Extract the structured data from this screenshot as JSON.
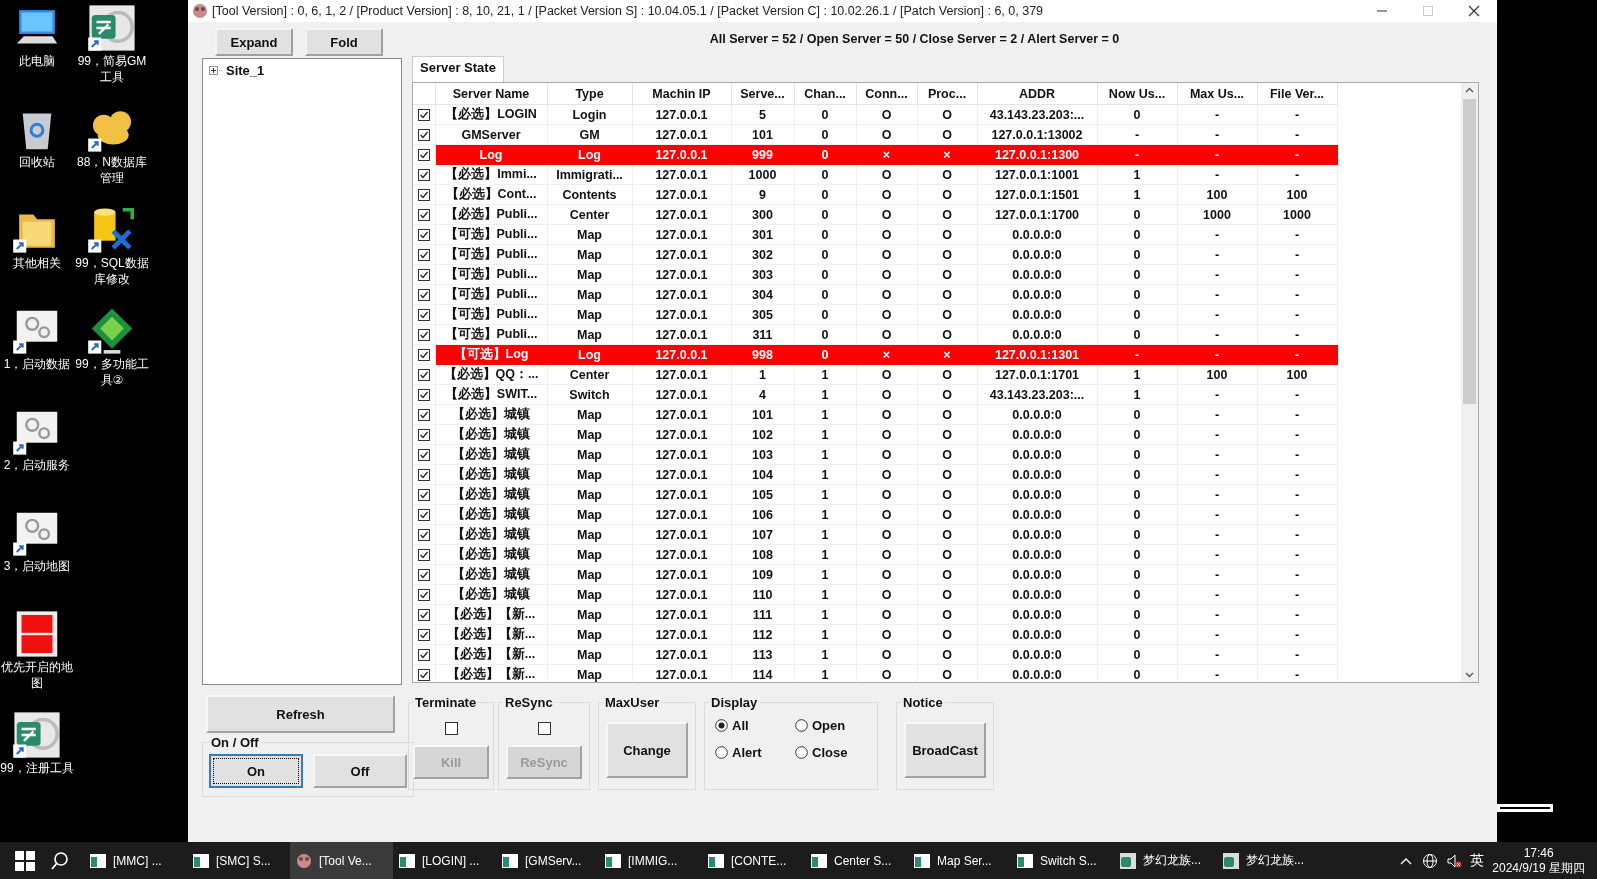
{
  "desktop": {
    "columns": [
      [
        {
          "label": "此电脑",
          "kind": "computer",
          "shortcut": false
        },
        {
          "label": "回收站",
          "kind": "recycle",
          "shortcut": false
        },
        {
          "label": "其他相关",
          "kind": "folder",
          "shortcut": true
        },
        {
          "label": "1，启动数据",
          "kind": "gears",
          "shortcut": true
        },
        {
          "label": "2，启动服务",
          "kind": "gears",
          "shortcut": true
        },
        {
          "label": "3，启动地图",
          "kind": "gears",
          "shortcut": true
        },
        {
          "label": "优先开启的地图",
          "kind": "redgrid",
          "shortcut": false
        },
        {
          "label": "99，注册工具",
          "kind": "gm",
          "shortcut": true
        }
      ],
      [
        {
          "label": "99，简易GM工具",
          "kind": "gm",
          "shortcut": true
        },
        {
          "label": "88，N数据库管理",
          "kind": "blob",
          "shortcut": true
        },
        {
          "label": "99，SQL数据库修改",
          "kind": "sql",
          "shortcut": true
        },
        {
          "label": "99，多功能工具②",
          "kind": "diamond",
          "shortcut": true
        }
      ]
    ]
  },
  "window": {
    "title": "[Tool Version] : 0, 6, 1, 2 / [Product Version] : 8, 10, 21, 1 / [Packet Version S] : 10.04.05.1 / [Packet Version C] : 10.02.26.1 / [Patch Version] : 6, 0, 379"
  },
  "tree_buttons": [
    "Expand",
    "Fold"
  ],
  "tree": [
    {
      "label": "Site_1",
      "expanded": false
    }
  ],
  "summary": "All Server = 52 / Open Server = 50 / Close Server = 2 / Alert Server = 0",
  "tabs": [
    {
      "label": "Server State",
      "selected": true
    }
  ],
  "table": {
    "columns": [
      "Server Name",
      "Type",
      "Machin IP",
      "Serve...",
      "Chan...",
      "Conn...",
      "Proc...",
      "ADDR",
      "Now Us...",
      "Max Us...",
      "File Ver..."
    ],
    "rows": [
      {
        "checked": true,
        "alert": false,
        "cells": [
          "【必选】LOGIN",
          "Login",
          "127.0.0.1",
          "5",
          "0",
          "O",
          "O",
          "43.143.23.203:...",
          "0",
          "-",
          "-"
        ]
      },
      {
        "checked": true,
        "alert": false,
        "cells": [
          "GMServer",
          "GM",
          "127.0.0.1",
          "101",
          "0",
          "O",
          "O",
          "127.0.0.1:13002",
          "-",
          "-",
          "-"
        ]
      },
      {
        "checked": true,
        "alert": true,
        "cells": [
          "Log",
          "Log",
          "127.0.0.1",
          "999",
          "0",
          "×",
          "×",
          "127.0.0.1:1300",
          "-",
          "-",
          "-"
        ]
      },
      {
        "checked": true,
        "alert": false,
        "cells": [
          "【必选】Immi...",
          "Immigrati...",
          "127.0.0.1",
          "1000",
          "0",
          "O",
          "O",
          "127.0.0.1:1001",
          "1",
          "-",
          "-"
        ]
      },
      {
        "checked": true,
        "alert": false,
        "cells": [
          "【必选】Cont...",
          "Contents",
          "127.0.0.1",
          "9",
          "0",
          "O",
          "O",
          "127.0.0.1:1501",
          "1",
          "100",
          "100"
        ]
      },
      {
        "checked": true,
        "alert": false,
        "cells": [
          "【必选】Publi...",
          "Center",
          "127.0.0.1",
          "300",
          "0",
          "O",
          "O",
          "127.0.0.1:1700",
          "0",
          "1000",
          "1000"
        ]
      },
      {
        "checked": true,
        "alert": false,
        "cells": [
          "【可选】Publi...",
          "Map",
          "127.0.0.1",
          "301",
          "0",
          "O",
          "O",
          "0.0.0.0:0",
          "0",
          "-",
          "-"
        ]
      },
      {
        "checked": true,
        "alert": false,
        "cells": [
          "【可选】Publi...",
          "Map",
          "127.0.0.1",
          "302",
          "0",
          "O",
          "O",
          "0.0.0.0:0",
          "0",
          "-",
          "-"
        ]
      },
      {
        "checked": true,
        "alert": false,
        "cells": [
          "【可选】Publi...",
          "Map",
          "127.0.0.1",
          "303",
          "0",
          "O",
          "O",
          "0.0.0.0:0",
          "0",
          "-",
          "-"
        ]
      },
      {
        "checked": true,
        "alert": false,
        "cells": [
          "【可选】Publi...",
          "Map",
          "127.0.0.1",
          "304",
          "0",
          "O",
          "O",
          "0.0.0.0:0",
          "0",
          "-",
          "-"
        ]
      },
      {
        "checked": true,
        "alert": false,
        "cells": [
          "【可选】Publi...",
          "Map",
          "127.0.0.1",
          "305",
          "0",
          "O",
          "O",
          "0.0.0.0:0",
          "0",
          "-",
          "-"
        ]
      },
      {
        "checked": true,
        "alert": false,
        "cells": [
          "【可选】Publi...",
          "Map",
          "127.0.0.1",
          "311",
          "0",
          "O",
          "O",
          "0.0.0.0:0",
          "0",
          "-",
          "-"
        ]
      },
      {
        "checked": true,
        "alert": true,
        "cells": [
          "【可选】Log",
          "Log",
          "127.0.0.1",
          "998",
          "0",
          "×",
          "×",
          "127.0.0.1:1301",
          "-",
          "-",
          "-"
        ]
      },
      {
        "checked": true,
        "alert": false,
        "cells": [
          "【必选】QQ：...",
          "Center",
          "127.0.0.1",
          "1",
          "1",
          "O",
          "O",
          "127.0.0.1:1701",
          "1",
          "100",
          "100"
        ]
      },
      {
        "checked": true,
        "alert": false,
        "cells": [
          "【必选】SWIT...",
          "Switch",
          "127.0.0.1",
          "4",
          "1",
          "O",
          "O",
          "43.143.23.203:...",
          "1",
          "-",
          "-"
        ]
      },
      {
        "checked": true,
        "alert": false,
        "cells": [
          "【必选】城镇",
          "Map",
          "127.0.0.1",
          "101",
          "1",
          "O",
          "O",
          "0.0.0.0:0",
          "0",
          "-",
          "-"
        ]
      },
      {
        "checked": true,
        "alert": false,
        "cells": [
          "【必选】城镇",
          "Map",
          "127.0.0.1",
          "102",
          "1",
          "O",
          "O",
          "0.0.0.0:0",
          "0",
          "-",
          "-"
        ]
      },
      {
        "checked": true,
        "alert": false,
        "cells": [
          "【必选】城镇",
          "Map",
          "127.0.0.1",
          "103",
          "1",
          "O",
          "O",
          "0.0.0.0:0",
          "0",
          "-",
          "-"
        ]
      },
      {
        "checked": true,
        "alert": false,
        "cells": [
          "【必选】城镇",
          "Map",
          "127.0.0.1",
          "104",
          "1",
          "O",
          "O",
          "0.0.0.0:0",
          "0",
          "-",
          "-"
        ]
      },
      {
        "checked": true,
        "alert": false,
        "cells": [
          "【必选】城镇",
          "Map",
          "127.0.0.1",
          "105",
          "1",
          "O",
          "O",
          "0.0.0.0:0",
          "0",
          "-",
          "-"
        ]
      },
      {
        "checked": true,
        "alert": false,
        "cells": [
          "【必选】城镇",
          "Map",
          "127.0.0.1",
          "106",
          "1",
          "O",
          "O",
          "0.0.0.0:0",
          "0",
          "-",
          "-"
        ]
      },
      {
        "checked": true,
        "alert": false,
        "cells": [
          "【必选】城镇",
          "Map",
          "127.0.0.1",
          "107",
          "1",
          "O",
          "O",
          "0.0.0.0:0",
          "0",
          "-",
          "-"
        ]
      },
      {
        "checked": true,
        "alert": false,
        "cells": [
          "【必选】城镇",
          "Map",
          "127.0.0.1",
          "108",
          "1",
          "O",
          "O",
          "0.0.0.0:0",
          "0",
          "-",
          "-"
        ]
      },
      {
        "checked": true,
        "alert": false,
        "cells": [
          "【必选】城镇",
          "Map",
          "127.0.0.1",
          "109",
          "1",
          "O",
          "O",
          "0.0.0.0:0",
          "0",
          "-",
          "-"
        ]
      },
      {
        "checked": true,
        "alert": false,
        "cells": [
          "【必选】城镇",
          "Map",
          "127.0.0.1",
          "110",
          "1",
          "O",
          "O",
          "0.0.0.0:0",
          "0",
          "-",
          "-"
        ]
      },
      {
        "checked": true,
        "alert": false,
        "cells": [
          "【必选】【新...",
          "Map",
          "127.0.0.1",
          "111",
          "1",
          "O",
          "O",
          "0.0.0.0:0",
          "0",
          "-",
          "-"
        ]
      },
      {
        "checked": true,
        "alert": false,
        "cells": [
          "【必选】【新...",
          "Map",
          "127.0.0.1",
          "112",
          "1",
          "O",
          "O",
          "0.0.0.0:0",
          "0",
          "-",
          "-"
        ]
      },
      {
        "checked": true,
        "alert": false,
        "cells": [
          "【必选】【新...",
          "Map",
          "127.0.0.1",
          "113",
          "1",
          "O",
          "O",
          "0.0.0.0:0",
          "0",
          "-",
          "-"
        ]
      },
      {
        "checked": true,
        "alert": false,
        "cells": [
          "【必选】【新...",
          "Map",
          "127.0.0.1",
          "114",
          "1",
          "O",
          "O",
          "0.0.0.0:0",
          "0",
          "-",
          "-"
        ]
      }
    ]
  },
  "refresh": "Refresh",
  "on_off": {
    "label": "On / Off",
    "buttons": [
      {
        "label": "On",
        "selected": true
      },
      {
        "label": "Off",
        "selected": false
      }
    ]
  },
  "terminate": {
    "label": "Terminate",
    "checked": false,
    "button": "Kill",
    "disabled": true
  },
  "resync": {
    "label": "ReSync",
    "checked": false,
    "button": "ReSync",
    "disabled": true
  },
  "max_user": {
    "label": "MaxUser",
    "button": "Change"
  },
  "display": {
    "label": "Display",
    "options": [
      {
        "label": "All",
        "selected": true
      },
      {
        "label": "Open",
        "selected": false
      },
      {
        "label": "Alert",
        "selected": false
      },
      {
        "label": "Close",
        "selected": false
      }
    ]
  },
  "notice": {
    "label": "Notice",
    "button": "BroadCast"
  },
  "taskbar": {
    "items": [
      {
        "label": "[MMC] ...",
        "kind": "console",
        "selected": false
      },
      {
        "label": "[SMC] S...",
        "kind": "console",
        "selected": false
      },
      {
        "label": "[Tool Ve...",
        "kind": "tool",
        "selected": true
      },
      {
        "label": "[LOGIN] ...",
        "kind": "console",
        "selected": false
      },
      {
        "label": "[GMServ...",
        "kind": "console",
        "selected": false
      },
      {
        "label": "[IMMIG...",
        "kind": "console",
        "selected": false
      },
      {
        "label": "[CONTE...",
        "kind": "console",
        "selected": false
      },
      {
        "label": "Center S...",
        "kind": "console",
        "selected": false
      },
      {
        "label": "Map Ser...",
        "kind": "console",
        "selected": false
      },
      {
        "label": "Switch S...",
        "kind": "console",
        "selected": false
      },
      {
        "label": "梦幻龙族...",
        "kind": "gm",
        "selected": false
      },
      {
        "label": "梦幻龙族...",
        "kind": "gm",
        "selected": false
      }
    ],
    "ime": "英",
    "time": "17:46",
    "date": "2024/9/19 星期四"
  }
}
